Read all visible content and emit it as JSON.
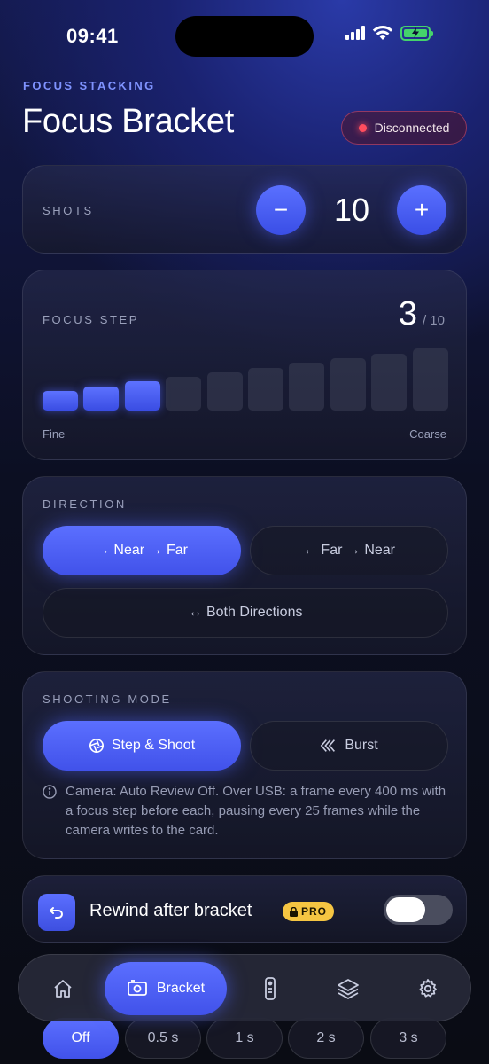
{
  "status_bar": {
    "time": "09:41"
  },
  "header": {
    "kicker": "FOCUS STACKING",
    "title": "Focus Bracket",
    "connection_status": "Disconnected"
  },
  "shots": {
    "label": "SHOTS",
    "value": "10",
    "minus": "−",
    "plus": "+"
  },
  "focus_step": {
    "label": "FOCUS STEP",
    "value": "3",
    "max": "/ 10",
    "selected_fraction": 0.3,
    "min_label": "Fine",
    "max_label": "Coarse"
  },
  "direction": {
    "label": "DIRECTION",
    "options": [
      {
        "label": "→ Near → Far",
        "selected": true
      },
      {
        "label": "← Far → Near",
        "selected": false
      },
      {
        "label": "↔ Both Directions",
        "selected": false
      }
    ]
  },
  "shooting_mode": {
    "label": "SHOOTING MODE",
    "options": [
      {
        "label": "Step & Shoot",
        "icon": "aperture-icon",
        "selected": true
      },
      {
        "label": "Burst",
        "icon": "burst-icon",
        "selected": false
      }
    ],
    "info": "Camera: Auto Review Off. Over USB: a frame every 400 ms with a focus step before each, pausing every 25 frames while the camera writes to the card."
  },
  "rewind": {
    "label": "Rewind after bracket",
    "pro_badge": "PRO",
    "enabled": false
  },
  "nav": {
    "active_label": "Bracket",
    "items": [
      "home-icon",
      "bracket-icon",
      "remote-icon",
      "layers-icon",
      "gear-icon"
    ]
  },
  "delay_chips": [
    "Off",
    "0.5 s",
    "1 s",
    "2 s",
    "3 s"
  ],
  "colors": {
    "accent": "#4a5ef5",
    "status_red": "#ff4d5e",
    "pro_yellow": "#f5c542",
    "battery_green": "#45d36b"
  }
}
